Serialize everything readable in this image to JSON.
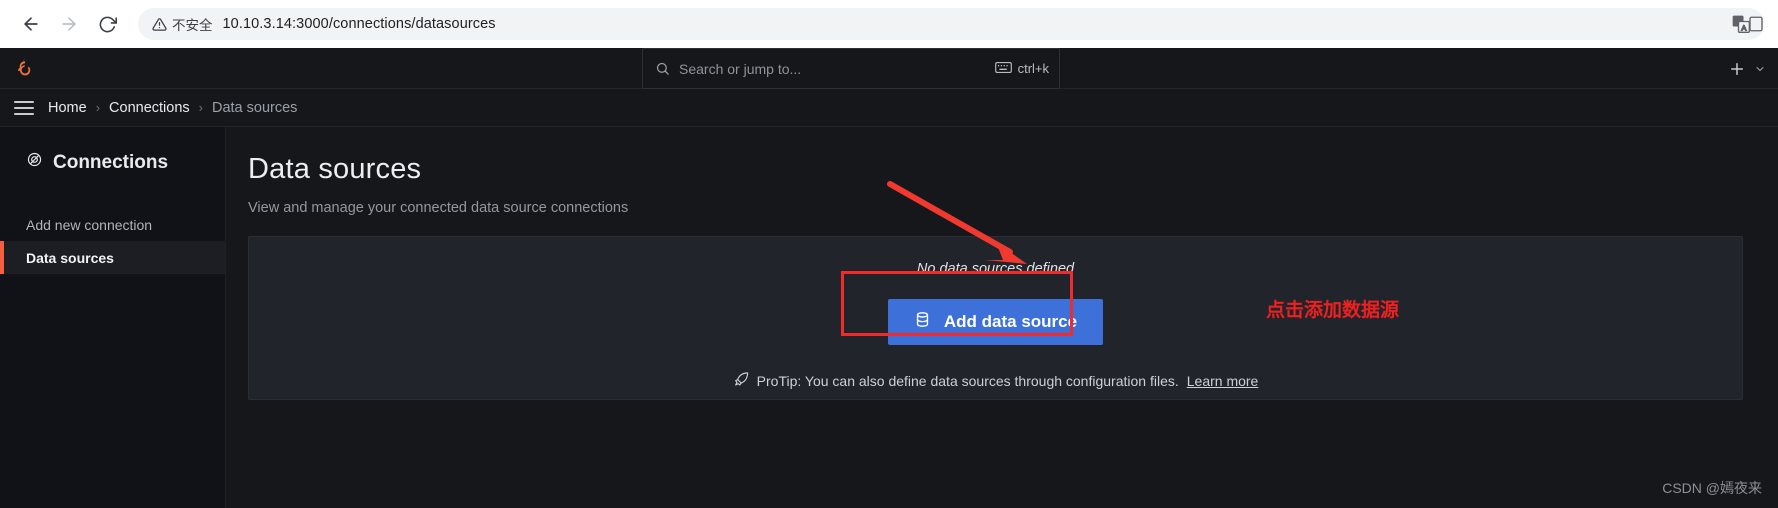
{
  "browser": {
    "back_icon": "arrow-left-icon",
    "forward_icon": "arrow-right-icon",
    "reload_icon": "reload-icon",
    "security_label": "不安全",
    "security_icon": "warning-triangle-icon",
    "url": "10.10.3.14:3000/connections/datasources",
    "translate_icon": "translate-icon",
    "extension_icon": "extension-icon"
  },
  "topnav": {
    "logo_icon": "grafana-logo-icon",
    "search": {
      "icon": "search-icon",
      "placeholder": "Search or jump to...",
      "shortcut": "ctrl+k",
      "shortcut_icon": "keyboard-icon"
    },
    "plus_icon": "plus-icon",
    "chevron_icon": "chevron-down-icon"
  },
  "breadcrumb": {
    "menu_icon": "hamburger-menu-icon",
    "items": [
      {
        "label": "Home"
      },
      {
        "label": "Connections"
      },
      {
        "label": "Data sources"
      }
    ],
    "separator": "›"
  },
  "sidebar": {
    "title": "Connections",
    "title_icon": "connections-icon",
    "items": [
      {
        "label": "Add new connection",
        "active": false
      },
      {
        "label": "Data sources",
        "active": true
      }
    ],
    "active_accent": "#f55f3e"
  },
  "main": {
    "title": "Data sources",
    "subtitle": "View and manage your connected data source connections",
    "empty_message": "No data sources defined",
    "add_button": {
      "label": "Add data source",
      "icon": "database-icon",
      "color": "#3d71d9"
    },
    "protip": {
      "icon": "rocket-icon",
      "text": "ProTip: You can also define data sources through configuration files.",
      "link_label": "Learn more"
    }
  },
  "annotations": {
    "highlight_color": "#ef2b2b",
    "callout_text": "点击添加数据源",
    "arrow_icon": "red-arrow-icon",
    "highlight_rect_name": "add-data-source-highlight"
  },
  "watermark": {
    "text": "CSDN @嫣夜来"
  }
}
